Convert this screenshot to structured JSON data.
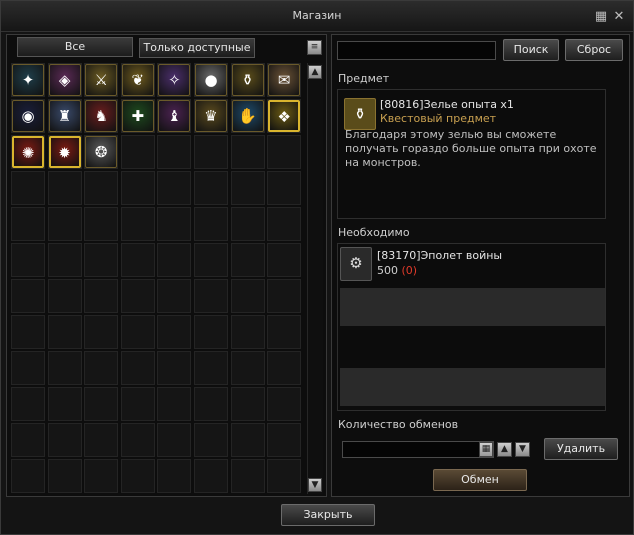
{
  "window": {
    "title": "Магазин"
  },
  "tabs": [
    {
      "label": "Все",
      "active": true
    },
    {
      "label": "Только доступные",
      "active": false
    }
  ],
  "shop_items": [
    {
      "name": "teal-crystal-icon",
      "glyph": "✦",
      "bg": "#1f3e4a",
      "gold": false
    },
    {
      "name": "pink-shield-icon",
      "glyph": "◈",
      "bg": "#5a2a55",
      "gold": false
    },
    {
      "name": "golden-sword-shield-icon",
      "glyph": "⚔",
      "bg": "#6a5a22",
      "gold": false
    },
    {
      "name": "golden-wing-icon",
      "glyph": "❦",
      "bg": "#6d5a1e",
      "gold": false
    },
    {
      "name": "purple-rune-icon",
      "glyph": "✧",
      "bg": "#4a2e6a",
      "gold": false
    },
    {
      "name": "silver-orb-icon",
      "glyph": "●",
      "bg": "#6a6a6a",
      "gold": false
    },
    {
      "name": "experience-potion-icon",
      "glyph": "⚱",
      "bg": "#5a4c1a",
      "gold": false
    },
    {
      "name": "envelope-icon",
      "glyph": "✉",
      "bg": "#6a5236",
      "gold": false
    },
    {
      "name": "dark-crystal-ball-icon",
      "glyph": "◉",
      "bg": "#1a1e3a",
      "gold": false
    },
    {
      "name": "hooded-figure-icon",
      "glyph": "♜",
      "bg": "#3a4a6a",
      "gold": false
    },
    {
      "name": "red-demon-icon",
      "glyph": "♞",
      "bg": "#6a1e1e",
      "gold": false
    },
    {
      "name": "green-sword-icon",
      "glyph": "✚",
      "bg": "#1e4a1e",
      "gold": false
    },
    {
      "name": "purple-dragon-icon",
      "glyph": "♝",
      "bg": "#4a2250",
      "gold": false
    },
    {
      "name": "golden-statue-icon",
      "glyph": "♛",
      "bg": "#5a4a1e",
      "gold": false
    },
    {
      "name": "blue-hand-icon",
      "glyph": "✋",
      "bg": "#1e4a6a",
      "gold": false
    },
    {
      "name": "yellow-box-icon",
      "glyph": "❖",
      "bg": "#6a5a12",
      "gold": true
    },
    {
      "name": "red-gold-emblem-icon",
      "glyph": "✺",
      "bg": "#7a1a12",
      "gold": true
    },
    {
      "name": "red-gold-emblem-icon-2",
      "glyph": "✹",
      "bg": "#7a1a12",
      "gold": true
    },
    {
      "name": "white-tusk-icon",
      "glyph": "❂",
      "bg": "#5a5a5a",
      "gold": false
    }
  ],
  "search": {
    "value": "",
    "placeholder": "",
    "search_label": "Поиск",
    "reset_label": "Сброс"
  },
  "item_section": {
    "heading": "Предмет",
    "item_name": "[80816]Зелье опыта x1",
    "item_type": "Квестовый предмет",
    "description": "Благодаря этому зелью вы сможете получать гораздо больше опыта при охоте на монстров."
  },
  "required_section": {
    "heading": "Необходимо",
    "item_name": "[83170]Эполет войны",
    "amount": "500",
    "owned": "(0)"
  },
  "exchange": {
    "heading": "Количество обменов",
    "value": "",
    "delete_label": "Удалить",
    "exchange_label": "Обмен"
  },
  "footer": {
    "close_label": "Закрыть"
  },
  "colors": {
    "accent_gold": "#d9b52e",
    "item_type": "#c8a050",
    "owned_red": "#e03a2a"
  }
}
